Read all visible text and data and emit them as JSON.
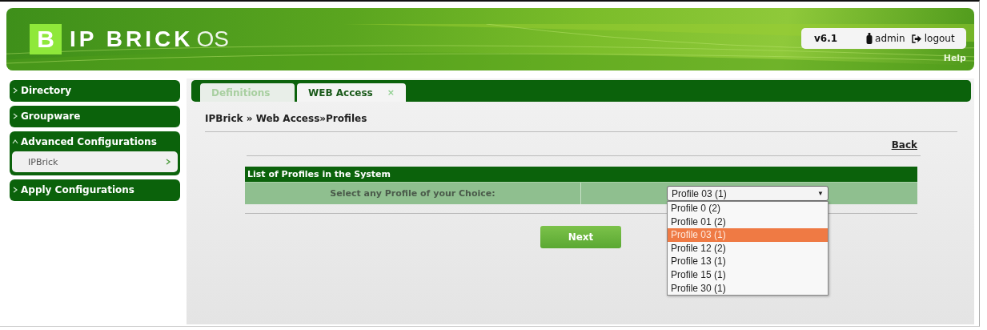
{
  "header": {
    "logo_mark": "B",
    "logo_name": "IP BRICK",
    "logo_suffix": "OS",
    "version": "v6.1",
    "user": "admin",
    "logout": "logout",
    "help": "Help"
  },
  "sidebar": {
    "items": [
      {
        "label": "Directory",
        "expanded": false
      },
      {
        "label": "Groupware",
        "expanded": false
      },
      {
        "label": "Advanced Configurations",
        "expanded": true,
        "children": [
          {
            "label": "IPBrick"
          }
        ]
      },
      {
        "label": "Apply Configurations",
        "expanded": false
      }
    ]
  },
  "tabs": [
    {
      "label": "Definitions",
      "selected": false
    },
    {
      "label": "WEB Access",
      "selected": true,
      "close": "×"
    }
  ],
  "breadcrumb": "IPBrick » Web Access»Profiles",
  "back_link": "Back",
  "profiles_table": {
    "title": "List of Profiles in the System",
    "label": "Select any Profile of your Choice:",
    "select": {
      "value": "Profile 03 (1)",
      "arrow": "▼",
      "options": [
        {
          "label": "Profile 0 (2)",
          "selected": false
        },
        {
          "label": "Profile 01 (2)",
          "selected": false
        },
        {
          "label": "Profile 03 (1)",
          "selected": true
        },
        {
          "label": "Profile 12 (2)",
          "selected": false
        },
        {
          "label": "Profile 13 (1)",
          "selected": false
        },
        {
          "label": "Profile 15 (1)",
          "selected": false
        },
        {
          "label": "Profile 30 (1)",
          "selected": false
        }
      ]
    }
  },
  "next_button": "Next"
}
